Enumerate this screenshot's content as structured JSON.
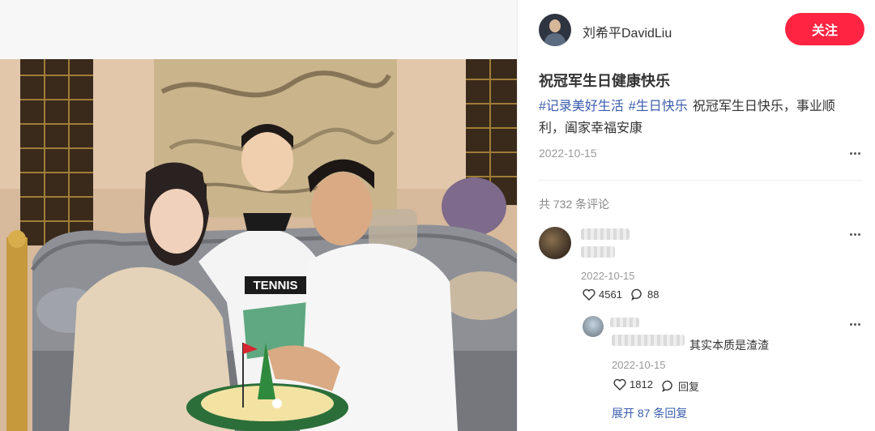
{
  "author": {
    "name": "刘希平DavidLiu",
    "follow_label": "关注"
  },
  "note": {
    "title": "祝冠军生日健康快乐",
    "tags": [
      "#记录美好生活",
      "#生日快乐"
    ],
    "desc_line1": "祝冠军生日快乐，事业顺",
    "desc_line2": "利，阖家幸福安康",
    "date": "2022-10-15"
  },
  "comments": {
    "count_label": "共 732 条评论",
    "first": {
      "date": "2022-10-15",
      "likes": "4561",
      "replies": "88"
    },
    "reply": {
      "text_visible": "其实本质是渣渣",
      "date": "2022-10-15",
      "likes": "1812",
      "reply_label": "回复"
    },
    "expand_label": "展开 87 条回复"
  },
  "photo": {
    "shirt_text": "TENNIS"
  },
  "colors": {
    "accent": "#ff2442",
    "tag": "#3b5cad",
    "muted": "#999999"
  }
}
